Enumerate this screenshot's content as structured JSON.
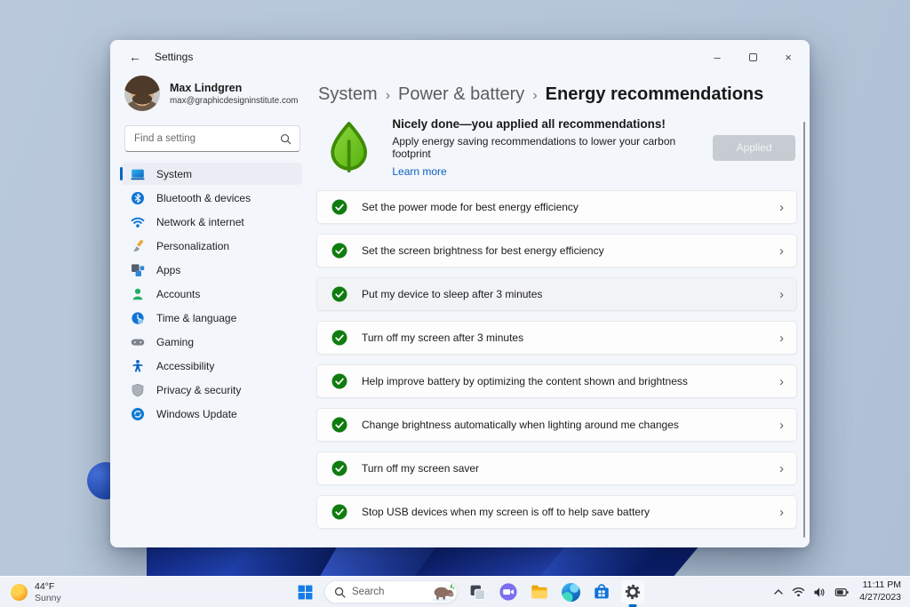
{
  "window": {
    "title": "Settings",
    "controls": {
      "minimize": "–",
      "close": "×"
    }
  },
  "sidebar": {
    "profile": {
      "name": "Max Lindgren",
      "email": "max@graphicdesigninstitute.com"
    },
    "search_placeholder": "Find a setting",
    "items": [
      {
        "label": "System",
        "icon": "system-icon",
        "selected": true
      },
      {
        "label": "Bluetooth & devices",
        "icon": "bluetooth-icon"
      },
      {
        "label": "Network & internet",
        "icon": "network-icon"
      },
      {
        "label": "Personalization",
        "icon": "personalization-icon"
      },
      {
        "label": "Apps",
        "icon": "apps-icon"
      },
      {
        "label": "Accounts",
        "icon": "accounts-icon"
      },
      {
        "label": "Time & language",
        "icon": "time-language-icon"
      },
      {
        "label": "Gaming",
        "icon": "gaming-icon"
      },
      {
        "label": "Accessibility",
        "icon": "accessibility-icon"
      },
      {
        "label": "Privacy & security",
        "icon": "privacy-security-icon"
      },
      {
        "label": "Windows Update",
        "icon": "windows-update-icon"
      }
    ]
  },
  "breadcrumb": {
    "items": [
      "System",
      "Power & battery",
      "Energy recommendations"
    ],
    "separator": "›"
  },
  "banner": {
    "title": "Nicely done—you applied all recommendations!",
    "subtitle": "Apply energy saving recommendations to lower your carbon footprint",
    "link": "Learn more",
    "button": "Applied"
  },
  "recommendations": {
    "items": [
      {
        "label": "Set the power mode for best energy efficiency"
      },
      {
        "label": "Set the screen brightness for best energy efficiency"
      },
      {
        "label": "Put my device to sleep after 3 minutes",
        "highlighted": true
      },
      {
        "label": "Turn off my screen after 3 minutes"
      },
      {
        "label": "Help improve battery by optimizing the content shown and brightness"
      },
      {
        "label": "Change brightness automatically when lighting around me changes"
      },
      {
        "label": "Turn off my screen saver"
      },
      {
        "label": "Stop USB devices when my screen is off to help save battery"
      }
    ]
  },
  "icons": {
    "chevron_right": "›",
    "back_arrow": "←"
  },
  "taskbar": {
    "weather": {
      "temp": "44°F",
      "condition": "Sunny"
    },
    "search_label": "Search",
    "icons": [
      "start",
      "search",
      "task-view",
      "chat",
      "file-explorer",
      "edge",
      "store",
      "settings"
    ],
    "tray": {
      "time": "11:11 PM",
      "date": "4/27/2023"
    }
  },
  "colors": {
    "accent": "#0067c0",
    "success_green": "#107c10",
    "leaf_green": "#57b510",
    "link_blue": "#0a60c0"
  }
}
